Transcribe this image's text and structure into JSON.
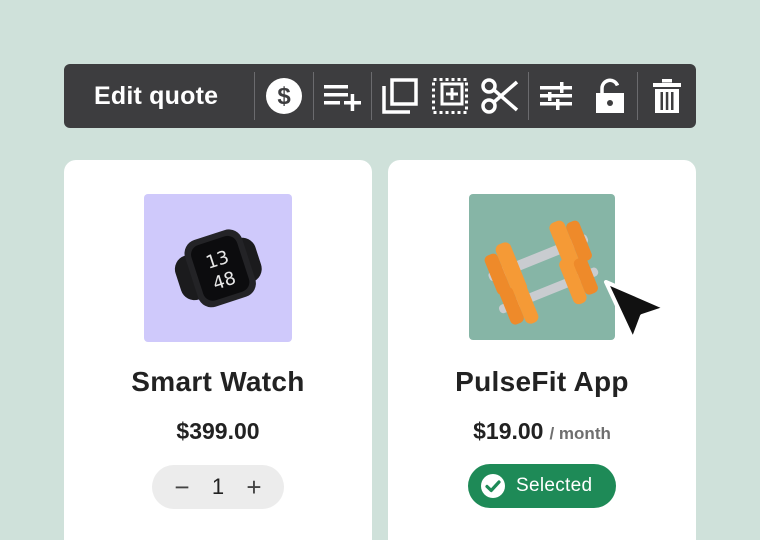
{
  "toolbar": {
    "title": "Edit quote",
    "icons": [
      "dollar-icon",
      "add-line-icon",
      "duplicate-icon",
      "select-add-icon",
      "cut-icon",
      "adjust-icon",
      "unlock-icon",
      "delete-icon"
    ]
  },
  "products": [
    {
      "name": "Smart Watch",
      "price": "$399.00",
      "quantity": "1",
      "watch_time_hour": "13",
      "watch_time_min": "48",
      "thumb_color": "#cfc9fb"
    },
    {
      "name": "PulseFit App",
      "price": "$19.00",
      "period": "/ month",
      "status": "Selected",
      "thumb_color": "#86b5a6",
      "status_color": "#1e8a57"
    }
  ],
  "colors": {
    "background": "#cfe1da",
    "toolbar": "#3d3d3f",
    "accent_green": "#1e8a57"
  }
}
